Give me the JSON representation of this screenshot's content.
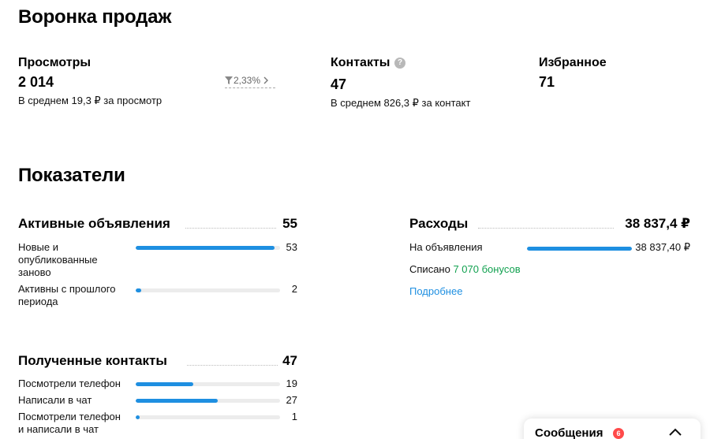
{
  "funnel": {
    "title": "Воронка продаж",
    "views": {
      "label": "Просмотры",
      "value": "2 014",
      "sub": "В среднем 19,3 ₽ за просмотр",
      "conversion": "2,33%"
    },
    "contacts": {
      "label": "Контакты",
      "help": "?",
      "value": "47",
      "sub": "В среднем 826,3 ₽ за контакт"
    },
    "favorites": {
      "label": "Избранное",
      "value": "71"
    }
  },
  "metrics": {
    "title": "Показатели",
    "active_ads": {
      "title": "Активные объявления",
      "total": "55",
      "rows": [
        {
          "label": "Новые и опубликованные заново",
          "value": "53",
          "fraction": 0.96
        },
        {
          "label": "Активны с прошлого периода",
          "value": "2",
          "fraction": 0.04
        }
      ]
    },
    "expenses": {
      "title": "Расходы",
      "total": "38 837,4 ₽",
      "row": {
        "label": "На объявления",
        "value": "38 837,40 ₽",
        "fraction": 1.0
      },
      "written_off_prefix": "Списано",
      "bonus_link": "7 070 бонусов",
      "more_link": "Подробнее"
    },
    "received_contacts": {
      "title": "Полученные контакты",
      "total": "47",
      "rows": [
        {
          "label": "Посмотрели телефон",
          "value": "19",
          "fraction": 0.4
        },
        {
          "label": "Написали в чат",
          "value": "27",
          "fraction": 0.57
        },
        {
          "label": "Посмотрели телефон и написали в чат",
          "value": "1",
          "fraction": 0.03
        }
      ]
    }
  },
  "messages_widget": {
    "label": "Сообщения",
    "badge": "6"
  },
  "colors": {
    "accent_blue": "#1e8fe1",
    "bonus_green": "#12a150",
    "badge_red": "#ff4a4a"
  }
}
